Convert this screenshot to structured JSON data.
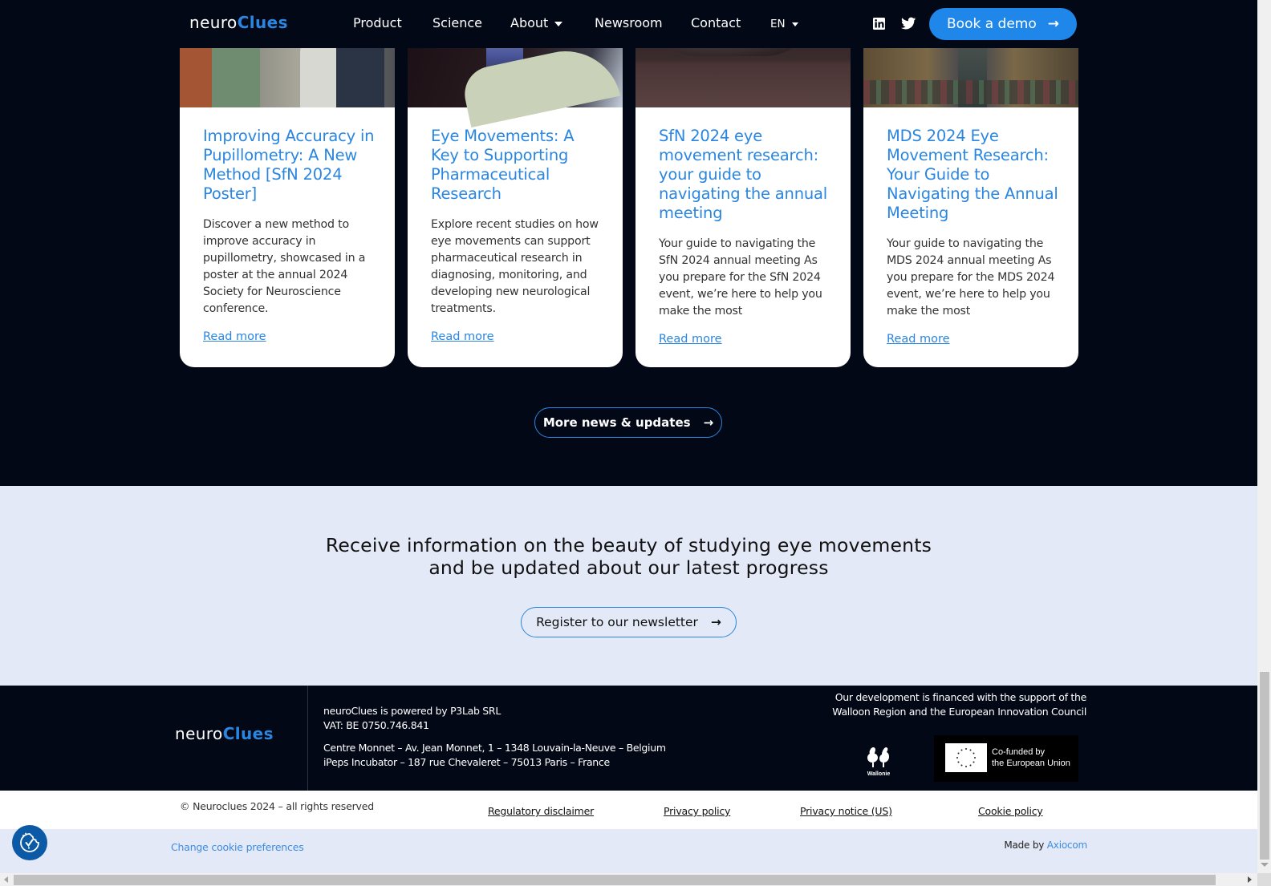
{
  "header": {
    "logo": {
      "part1": "neuro",
      "part2": "Clues"
    },
    "nav": [
      {
        "label": "Product"
      },
      {
        "label": "Science"
      },
      {
        "label": "About",
        "has_dropdown": true
      },
      {
        "label": "Newsroom"
      },
      {
        "label": "Contact"
      }
    ],
    "language": "EN",
    "social": [
      {
        "icon": "linkedin-icon"
      },
      {
        "icon": "twitter-icon"
      }
    ],
    "cta": {
      "label": "Book a demo",
      "icon": "arrow-right-icon"
    }
  },
  "news": {
    "cards": [
      {
        "image": "conference-poster-photo",
        "title": "Improving Accuracy in Pupillometry: A New Method [SfN 2024 Poster]",
        "description": "Discover a new method to improve accuracy in pupillometry, showcased in a poster at the annual 2024 Society for Neuroscience conference.",
        "link": "Read more"
      },
      {
        "image": "pharmaceutical-vial-photo",
        "title": "Eye Movements: A Key to Supporting Pharmaceutical Research",
        "description": "Explore recent studies on how eye movements can support pharmaceutical research in diagnosing, monitoring, and developing new neurological treatments.",
        "link": "Read more"
      },
      {
        "image": "chicago-bean-photo",
        "title": "SfN 2024 eye movement research: your guide to navigating the annual meeting",
        "description": "Your guide to navigating the SfN 2024 annual meeting As you prepare for the SfN 2024 event, we’re here to help you make the most",
        "link": "Read more"
      },
      {
        "image": "philadelphia-parkway-photo",
        "title": "MDS 2024 Eye Movement Research: Your Guide to Navigating the Annual Meeting",
        "description": "Your guide to navigating the MDS 2024 annual meeting As you prepare for the MDS 2024 event, we’re here to help you make the most",
        "link": "Read more"
      }
    ],
    "more_button": "More news & updates"
  },
  "newsletter": {
    "line1": "Receive information on the beauty of studying eye movements",
    "line2": "and be updated about our latest progress",
    "button": "Register to our newsletter"
  },
  "footer": {
    "logo": {
      "part1": "neuro",
      "part2": "Clues"
    },
    "company_line": "neuroClues is powered by P3Lab SRL",
    "vat": "VAT: BE 0750.746.841",
    "address1": "Centre Monnet – Av. Jean Monnet, 1 – 1348 Louvain-la-Neuve – Belgium",
    "address2": "iPeps Incubator – 187 rue Chevaleret – 75013 Paris – France",
    "funding_line1": "Our development is financed with the support of the",
    "funding_line2": "Walloon Region and the European Innovation Council",
    "wallonie_label": "Wallonie",
    "eu_line1": "Co-funded by",
    "eu_line2": "the European Union"
  },
  "legal": {
    "copyright": "© Neuroclues 2024 – all rights reserved",
    "links": [
      "Regulatory disclaimer",
      "Privacy policy",
      "Privacy notice (US)",
      "Cookie policy"
    ],
    "cookie_preferences": "Change cookie preferences",
    "made_by_prefix": "Made by",
    "made_by_link": "Axiocom"
  },
  "colors": {
    "brand_blue": "#2a86e0",
    "cta_blue": "#1f87ea",
    "dark_bg": "#030816",
    "light_bg": "#e4e9f7"
  }
}
